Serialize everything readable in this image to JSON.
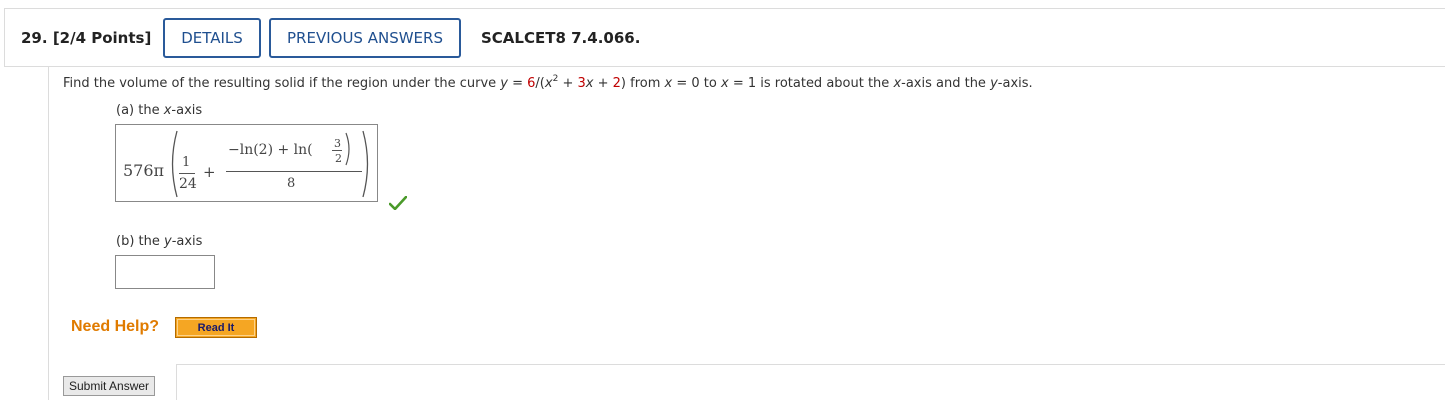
{
  "header": {
    "question_number": "29.",
    "points": "[2/4 Points]",
    "details_label": "DETAILS",
    "previous_answers_label": "PREVIOUS ANSWERS",
    "question_code": "SCALCET8 7.4.066."
  },
  "question": {
    "text_before": "Find the volume of the resulting solid if the region under the curve ",
    "y_var": "y",
    "eq_part1": " = ",
    "func_num": "6",
    "func_mid": "/(",
    "x_var": "x",
    "exp": "2",
    "plus1": " + ",
    "term": "3",
    "x_var2": "x",
    "plus2": " + ",
    "const": "2",
    "close": ")",
    "from": "  from ",
    "x0_var": "x",
    "x0_eq": " = 0 to ",
    "x1_var": "x",
    "x1_eq": " = 1 is rotated about the ",
    "axis1": "x",
    "axis_mid": "-axis and the ",
    "axis2": "y",
    "axis_end": "-axis."
  },
  "part_a": {
    "label_prefix": "(a) the ",
    "label_var": "x",
    "label_suffix": "-axis",
    "answer": {
      "coefficient": "576π",
      "frac1_num": "1",
      "frac1_den": "24",
      "plus": "+",
      "numerator_text": "−ln(2) + ln(",
      "inner_num": "3",
      "inner_den": "2",
      "frac2_den": "8"
    },
    "status": "correct"
  },
  "part_b": {
    "label_prefix": "(b) the ",
    "label_var": "y",
    "label_suffix": "-axis",
    "answer_value": ""
  },
  "help": {
    "need_help_label": "Need Help?",
    "read_it_label": "Read It"
  },
  "submit_label": "Submit Answer",
  "colors": {
    "accent_blue": "#2a5a9a",
    "highlight_red": "#c00000",
    "help_orange": "#e07b00",
    "check_green": "#4a9a2a"
  }
}
